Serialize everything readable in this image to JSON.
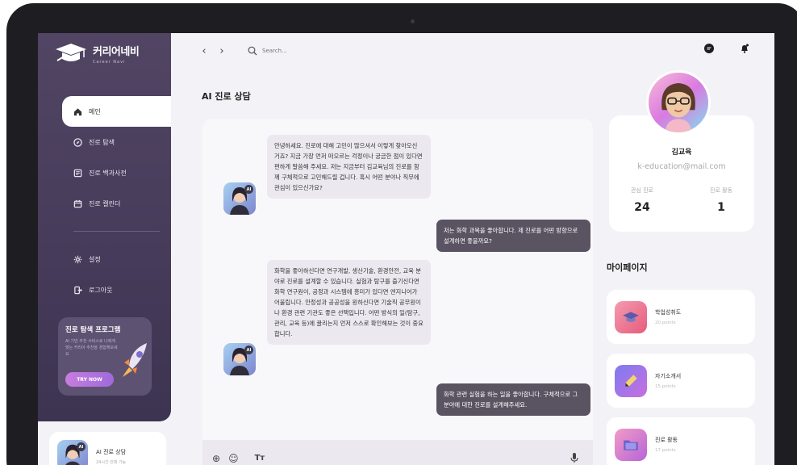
{
  "app": {
    "brand_name": "커리어네비",
    "brand_sub": "Career Navi"
  },
  "sidebar": {
    "items": [
      {
        "label": "메인",
        "icon": "home-icon",
        "active": true
      },
      {
        "label": "진로 탐색",
        "icon": "compass-icon"
      },
      {
        "label": "진로 백과사전",
        "icon": "book-icon"
      },
      {
        "label": "진로 캘린더",
        "icon": "calendar-icon"
      }
    ],
    "bottom_items": [
      {
        "label": "설정",
        "icon": "gear-icon"
      },
      {
        "label": "로그아웃",
        "icon": "logout-icon"
      }
    ],
    "promo": {
      "title": "진로 탐색 프로그램",
      "desc": "AI 기반 추천 서비스로 나에게 맞는 커리어 추천을 경험해보세요",
      "button": "TRY NOW"
    },
    "bottom_card": {
      "title": "AI 진로 상담",
      "sub": "24시간 언제 가능"
    }
  },
  "topbar": {
    "search_placeholder": "Search..."
  },
  "main": {
    "title": "AI 진로 상담"
  },
  "chat": {
    "messages": [
      {
        "role": "bot",
        "text": "안녕하세요. 진로에 대해 고민이 많으셔서 이렇게 찾아오신 거죠? 지금 가장 먼저 떠오르는 걱정이나 궁금한 점이 있다면 편하게 말씀해 주세요. 저는 지금부터 김교육님의 진로를 함께 구체적으로 고민해드릴 겁니다. 혹시 어떤 분야나 직무에 관심이 있으신가요?"
      },
      {
        "role": "user",
        "text": "저는 화학 과목을 좋아합니다. 제 진로를 어떤 방향으로 설계하면 좋을까요?"
      },
      {
        "role": "bot",
        "text": "화학을 좋아하신다면 연구개발, 생산기술, 환경안전, 교육 분야로 진로를 설계할 수 있습니다. 실험과 탐구를 즐기신다면 화학 연구원이, 공정과 시스템에 흥미가 있다면 엔지니어가 어울립니다. 안정성과 공공성을 원하신다면 기술직 공무원이나 환경 관련 기관도 좋은 선택입니다. 어떤 방식의 일(탐구, 관리, 교육 등)에 끌리는지 먼저 스스로 확인해보는 것이 중요합니다."
      },
      {
        "role": "user",
        "text": "화학 관련 실험을 하는 일을 좋아합니다. 구체적으로 그 분야에 대한 진로를 설계해주세요."
      }
    ],
    "ai_badge": "AI"
  },
  "profile": {
    "name": "김교육",
    "email": "k-education@mail.com",
    "stats": [
      {
        "label": "관심 진로",
        "value": "24"
      },
      {
        "label": "진로 활동",
        "value": "1"
      }
    ]
  },
  "mypage": {
    "title": "마이페이지",
    "cards": [
      {
        "label": "학업성취도",
        "points": "20 points",
        "color": "#ef6f8c"
      },
      {
        "label": "자기소개서",
        "points": "15 points",
        "color": "#8a6ee8"
      },
      {
        "label": "진로 활동",
        "points": "17 points",
        "color": "#d56fb8"
      }
    ]
  }
}
